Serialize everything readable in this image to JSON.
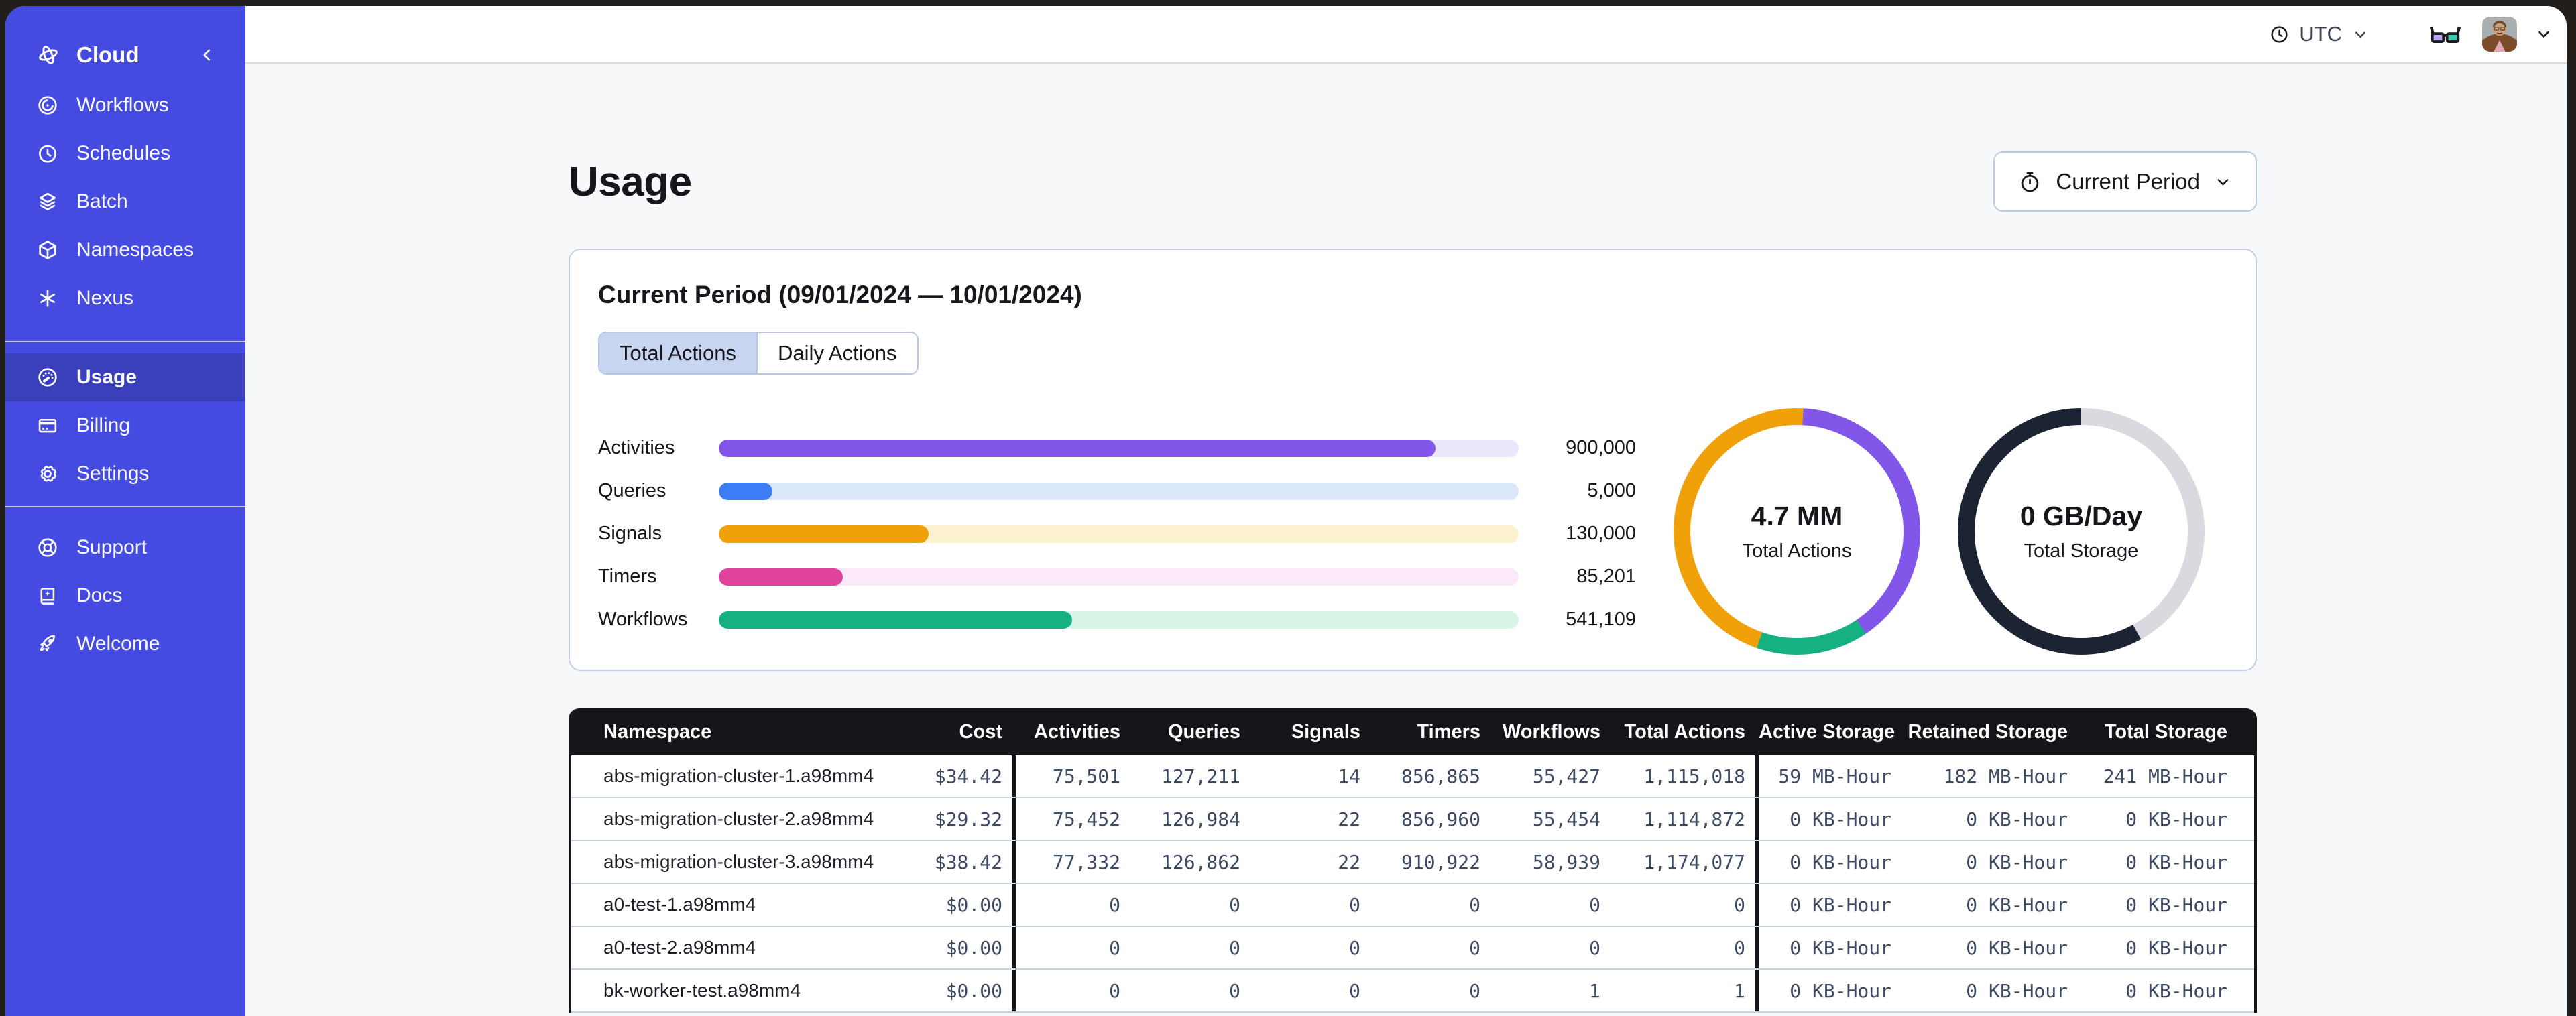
{
  "colors": {
    "sidebar_bg": "#454be0",
    "sidebar_active_bg": "#3a3fbb",
    "main_bg": "#f6f8fa",
    "table_header_bg": "#141419",
    "card_border": "#c3cfe5",
    "accent_purple": "#8156e9",
    "accent_blue": "#3d7df5",
    "accent_orange": "#f0a009",
    "accent_pink": "#e0439b",
    "accent_green": "#16b183",
    "storage_dark": "#1c2433"
  },
  "sidebar": {
    "brand": {
      "label": "Cloud"
    },
    "items": [
      {
        "label": "Workflows"
      },
      {
        "label": "Schedules"
      },
      {
        "label": "Batch"
      },
      {
        "label": "Namespaces"
      },
      {
        "label": "Nexus"
      }
    ],
    "account_items": [
      {
        "label": "Usage",
        "active": true
      },
      {
        "label": "Billing",
        "active": false
      },
      {
        "label": "Settings",
        "active": false
      }
    ],
    "footer_items": [
      {
        "label": "Support"
      },
      {
        "label": "Docs"
      },
      {
        "label": "Welcome"
      }
    ]
  },
  "topbar": {
    "timezone": "UTC",
    "icons": [
      "clock-icon",
      "chevron-down-icon",
      "glasses-icon",
      "avatar",
      "chevron-down-icon"
    ]
  },
  "page": {
    "title": "Usage",
    "period_selector": {
      "label": "Current Period",
      "icon": "stopwatch-icon"
    }
  },
  "usage_card": {
    "title": "Current Period (09/01/2024 — 10/01/2024)",
    "tabs": [
      {
        "label": "Total Actions",
        "active": true
      },
      {
        "label": "Daily Actions",
        "active": false
      }
    ]
  },
  "chart_data": [
    {
      "type": "bar",
      "orientation": "horizontal",
      "categories": [
        "Activities",
        "Queries",
        "Signals",
        "Timers",
        "Workflows"
      ],
      "values": [
        900000,
        5000,
        130000,
        85201,
        541109
      ],
      "value_labels": [
        "900,000",
        "5,000",
        "130,000",
        "85,201",
        "541,109"
      ],
      "fill_pct": [
        89.6,
        6.7,
        26.2,
        15.5,
        44.2
      ],
      "colors": [
        "#8156e9",
        "#3d7df5",
        "#f0a009",
        "#e0439b",
        "#16b183"
      ],
      "track_colors": [
        "#ece7fb",
        "#dbe7fb",
        "#fdf2cf",
        "#fbe8f8",
        "#d7f6e7"
      ],
      "legend": "none",
      "grid": false
    },
    {
      "type": "donut",
      "label": "4.7 MM",
      "sublabel": "Total Actions",
      "segments": [
        {
          "name": "orange-cap",
          "color": "#f0a009",
          "start_deg": 0,
          "end_deg": 3
        },
        {
          "name": "activities",
          "color": "#8156e9",
          "start_deg": 3,
          "end_deg": 146
        },
        {
          "name": "workflows",
          "color": "#16b183",
          "start_deg": 146,
          "end_deg": 199
        },
        {
          "name": "other-actions",
          "color": "#f0a009",
          "start_deg": 199,
          "end_deg": 360
        }
      ]
    },
    {
      "type": "donut",
      "label": "0 GB/Day",
      "sublabel": "Total Storage",
      "segments": [
        {
          "name": "remaining",
          "color": "#d9dadf",
          "start_deg": 0,
          "end_deg": 151
        },
        {
          "name": "used",
          "color": "#1c2433",
          "start_deg": 151,
          "end_deg": 360
        }
      ]
    }
  ],
  "table": {
    "columns": [
      "Namespace",
      "Cost",
      "Activities",
      "Queries",
      "Signals",
      "Timers",
      "Workflows",
      "Total Actions",
      "Active Storage",
      "Retained Storage",
      "Total Storage"
    ],
    "rows": [
      {
        "namespace": "abs-migration-cluster-1.a98mm4",
        "cost": "$34.42",
        "activities": "75,501",
        "queries": "127,211",
        "signals": "14",
        "timers": "856,865",
        "workflows": "55,427",
        "total_actions": "1,115,018",
        "active_storage": "59 MB-Hour",
        "retained_storage": "182 MB-Hour",
        "total_storage": "241 MB-Hour"
      },
      {
        "namespace": "abs-migration-cluster-2.a98mm4",
        "cost": "$29.32",
        "activities": "75,452",
        "queries": "126,984",
        "signals": "22",
        "timers": "856,960",
        "workflows": "55,454",
        "total_actions": "1,114,872",
        "active_storage": "0 KB-Hour",
        "retained_storage": "0 KB-Hour",
        "total_storage": "0 KB-Hour"
      },
      {
        "namespace": "abs-migration-cluster-3.a98mm4",
        "cost": "$38.42",
        "activities": "77,332",
        "queries": "126,862",
        "signals": "22",
        "timers": "910,922",
        "workflows": "58,939",
        "total_actions": "1,174,077",
        "active_storage": "0 KB-Hour",
        "retained_storage": "0 KB-Hour",
        "total_storage": "0 KB-Hour"
      },
      {
        "namespace": "a0-test-1.a98mm4",
        "cost": "$0.00",
        "activities": "0",
        "queries": "0",
        "signals": "0",
        "timers": "0",
        "workflows": "0",
        "total_actions": "0",
        "active_storage": "0 KB-Hour",
        "retained_storage": "0 KB-Hour",
        "total_storage": "0 KB-Hour"
      },
      {
        "namespace": "a0-test-2.a98mm4",
        "cost": "$0.00",
        "activities": "0",
        "queries": "0",
        "signals": "0",
        "timers": "0",
        "workflows": "0",
        "total_actions": "0",
        "active_storage": "0 KB-Hour",
        "retained_storage": "0 KB-Hour",
        "total_storage": "0 KB-Hour"
      },
      {
        "namespace": "bk-worker-test.a98mm4",
        "cost": "$0.00",
        "activities": "0",
        "queries": "0",
        "signals": "0",
        "timers": "0",
        "workflows": "1",
        "total_actions": "1",
        "active_storage": "0 KB-Hour",
        "retained_storage": "0 KB-Hour",
        "total_storage": "0 KB-Hour"
      }
    ]
  }
}
